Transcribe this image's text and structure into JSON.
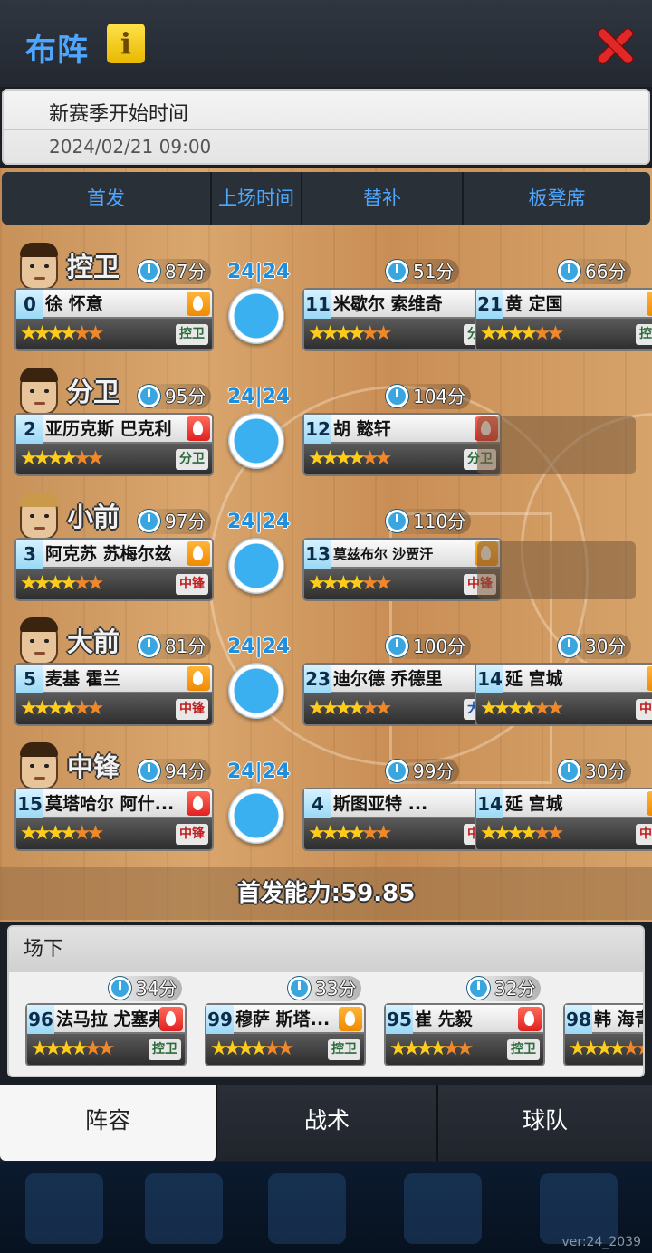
{
  "header": {
    "title": "布阵",
    "info_icon": "i"
  },
  "season": {
    "label": "新赛季开始时间",
    "date": "2024/02/21 09:00"
  },
  "tabs": [
    "首发",
    "上场时间",
    "替补",
    "板凳席"
  ],
  "rows": [
    {
      "pos": "控卫",
      "starter": {
        "num": "0",
        "name": "徐 怀意",
        "minutes": "87分",
        "stars": "★★★★★★★★",
        "fire": "orange",
        "badge": "控卫"
      },
      "score": "24|24",
      "sub": {
        "num": "11",
        "name": "米歇尔 索维奇",
        "minutes": "51分",
        "fire": "red",
        "badge": "分卫"
      },
      "bench": {
        "num": "21",
        "name": "黄 定国",
        "minutes": "66分",
        "fire": "orange",
        "badge": "控卫"
      }
    },
    {
      "pos": "分卫",
      "starter": {
        "num": "2",
        "name": "亚历克斯 巴克利",
        "minutes": "95分",
        "fire": "red",
        "badge": "分卫"
      },
      "score": "24|24",
      "sub": {
        "num": "12",
        "name": "胡 懿轩",
        "minutes": "104分",
        "fire": "red",
        "badge": "分卫"
      },
      "bench": null
    },
    {
      "pos": "小前",
      "starter": {
        "num": "3",
        "name": "阿克苏 苏梅尔兹",
        "minutes": "97分",
        "fire": "orange",
        "badge": "中锋"
      },
      "score": "24|24",
      "sub": {
        "num": "13",
        "name": "莫兹布尔 沙贾汗",
        "minutes": "110分",
        "fire": "orange",
        "badge": "中锋"
      },
      "bench": null
    },
    {
      "pos": "大前",
      "starter": {
        "num": "5",
        "name": "麦基 霍兰",
        "minutes": "81分",
        "fire": "orange",
        "badge": "中锋"
      },
      "score": "24|24",
      "sub": {
        "num": "23",
        "name": "迪尔德 乔德里",
        "minutes": "100分",
        "fire": "orange",
        "badge": "大前"
      },
      "bench": {
        "num": "14",
        "name": "延 宫城",
        "minutes": "30分",
        "fire": "orange",
        "badge": "中锋"
      }
    },
    {
      "pos": "中锋",
      "starter": {
        "num": "15",
        "name": "莫塔哈尔 阿什...",
        "minutes": "94分",
        "fire": "red",
        "badge": "中锋"
      },
      "score": "24|24",
      "sub": {
        "num": "4",
        "name": "斯图亚特 ...",
        "minutes": "99分",
        "fire": "orange",
        "badge": "中锋"
      },
      "bench": {
        "num": "14",
        "name": "延 宫城",
        "minutes": "30分",
        "fire": "orange",
        "badge": "中锋"
      }
    }
  ],
  "power": "首发能力:59.85",
  "offcourt": {
    "title": "场下",
    "players": [
      {
        "num": "96",
        "name": "法马拉 尤塞弗",
        "minutes": "34分",
        "fire": "red",
        "badge": "控卫"
      },
      {
        "num": "99",
        "name": "穆萨 斯塔...",
        "minutes": "33分",
        "fire": "orange",
        "badge": "控卫"
      },
      {
        "num": "95",
        "name": "崔 先毅",
        "minutes": "32分",
        "fire": "red",
        "badge": "控卫"
      },
      {
        "num": "98",
        "name": "韩 海青",
        "minutes": "",
        "fire": "orange",
        "badge": ""
      }
    ]
  },
  "bottom_tabs": [
    "阵容",
    "战术",
    "球队"
  ],
  "version": "ver:24_2039"
}
